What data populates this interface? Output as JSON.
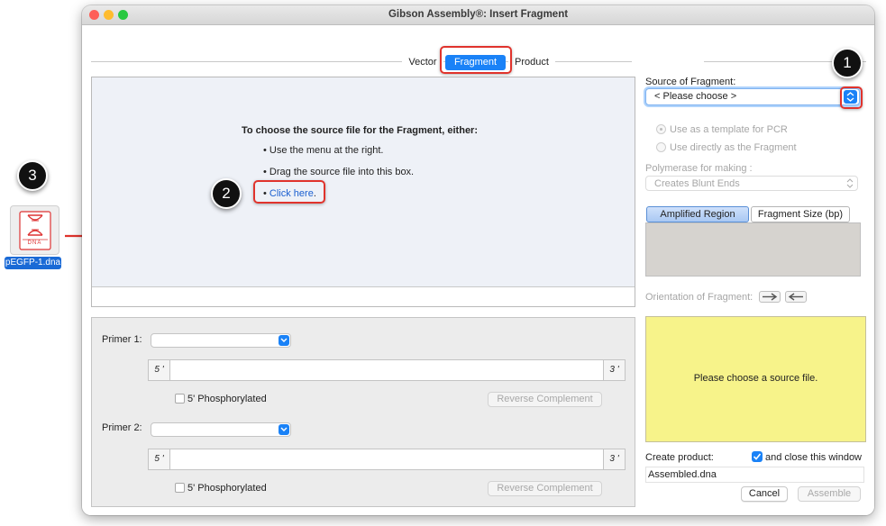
{
  "window": {
    "title": "Gibson Assembly®: Insert Fragment"
  },
  "tabs": [
    "Vector",
    "Fragment",
    "Product"
  ],
  "drop": {
    "heading": "To choose the source file for the Fragment, either:",
    "bullet1": "Use the menu at the right.",
    "bullet2": "Drag the source file into this box.",
    "bullet3_link": "Click here",
    "bullet3_suffix": "."
  },
  "primers": {
    "primer1_label": "Primer 1:",
    "primer2_label": "Primer 2:",
    "five_prime": "5 '",
    "three_prime": "3 '",
    "phosphorylated": "5' Phosphorylated",
    "reverse_complement": "Reverse Complement"
  },
  "source": {
    "label": "Source of Fragment:",
    "selected": "< Please choose >",
    "opt_template": "Use as a template for PCR",
    "opt_direct": "Use directly as the Fragment",
    "polymerase_label": "Polymerase for making :",
    "polymerase_value": "Creates Blunt Ends"
  },
  "region": {
    "amplified_tab": "Amplified Region",
    "size_tab": "Fragment Size (bp)",
    "orientation_label": "Orientation of Fragment:"
  },
  "preview": {
    "message": "Please choose a source file."
  },
  "product": {
    "create_label": "Create product:",
    "close_window": "and close this window",
    "close_checked": true,
    "filename": "Assembled.dna",
    "cancel": "Cancel",
    "assemble": "Assemble"
  },
  "file": {
    "icon_label": "DNA",
    "name": "pEGFP-1.dna"
  },
  "badges": [
    "1",
    "2",
    "3"
  ],
  "colors": {
    "accent": "#1a82f7",
    "highlight": "#e0332c",
    "preview_bg": "#f7f38a"
  }
}
